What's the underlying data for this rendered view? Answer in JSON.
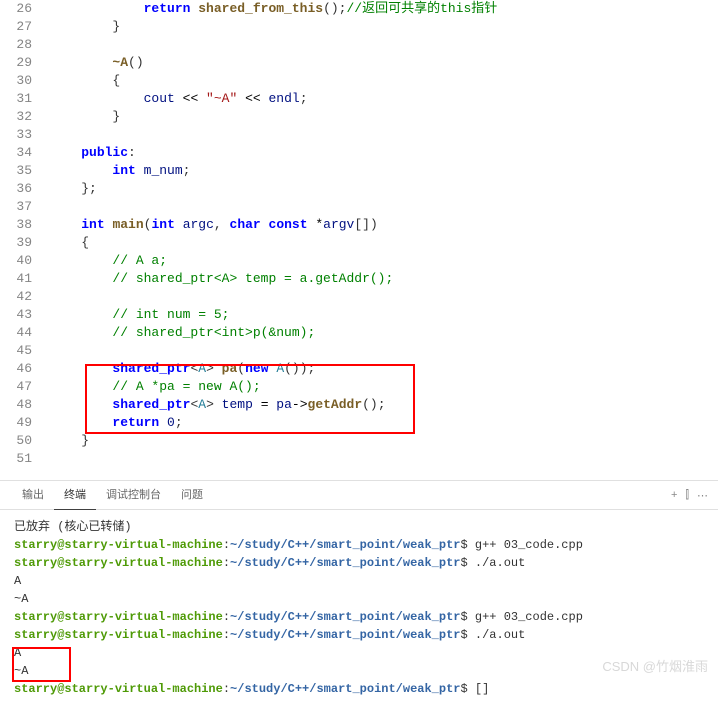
{
  "code": {
    "lines": [
      {
        "num": 26,
        "indent": 3,
        "tokens": [
          {
            "t": "return ",
            "c": "keyword"
          },
          {
            "t": "shared_from_this",
            "c": "funcname"
          },
          {
            "t": "();",
            "c": "punct"
          },
          {
            "t": "//返回可共享的this指针",
            "c": "comment"
          }
        ]
      },
      {
        "num": 27,
        "indent": 2,
        "tokens": [
          {
            "t": "}",
            "c": "punct"
          }
        ]
      },
      {
        "num": 28,
        "indent": 0,
        "tokens": []
      },
      {
        "num": 29,
        "indent": 2,
        "tokens": [
          {
            "t": "~A",
            "c": "funcname"
          },
          {
            "t": "()",
            "c": "punct"
          }
        ]
      },
      {
        "num": 30,
        "indent": 2,
        "tokens": [
          {
            "t": "{",
            "c": "punct"
          }
        ]
      },
      {
        "num": 31,
        "indent": 3,
        "tokens": [
          {
            "t": "cout ",
            "c": "varname"
          },
          {
            "t": "<< ",
            "c": "operator"
          },
          {
            "t": "\"~A\"",
            "c": "string"
          },
          {
            "t": " << ",
            "c": "operator"
          },
          {
            "t": "endl",
            "c": "varname"
          },
          {
            "t": ";",
            "c": "punct"
          }
        ]
      },
      {
        "num": 32,
        "indent": 2,
        "tokens": [
          {
            "t": "}",
            "c": "punct"
          }
        ]
      },
      {
        "num": 33,
        "indent": 0,
        "tokens": []
      },
      {
        "num": 34,
        "indent": 1,
        "tokens": [
          {
            "t": "public",
            "c": "keyword"
          },
          {
            "t": ":",
            "c": "punct"
          }
        ]
      },
      {
        "num": 35,
        "indent": 2,
        "tokens": [
          {
            "t": "int ",
            "c": "keyword"
          },
          {
            "t": "m_num",
            "c": "varname"
          },
          {
            "t": ";",
            "c": "punct"
          }
        ]
      },
      {
        "num": 36,
        "indent": 1,
        "tokens": [
          {
            "t": "};",
            "c": "punct"
          }
        ]
      },
      {
        "num": 37,
        "indent": 0,
        "tokens": []
      },
      {
        "num": 38,
        "indent": 1,
        "tokens": [
          {
            "t": "int ",
            "c": "keyword"
          },
          {
            "t": "main",
            "c": "funcname"
          },
          {
            "t": "(",
            "c": "punct"
          },
          {
            "t": "int ",
            "c": "keyword"
          },
          {
            "t": "argc",
            "c": "varname"
          },
          {
            "t": ", ",
            "c": "punct"
          },
          {
            "t": "char const ",
            "c": "keyword"
          },
          {
            "t": "*",
            "c": "operator"
          },
          {
            "t": "argv",
            "c": "varname"
          },
          {
            "t": "[])",
            "c": "punct"
          }
        ]
      },
      {
        "num": 39,
        "indent": 1,
        "tokens": [
          {
            "t": "{",
            "c": "punct"
          }
        ]
      },
      {
        "num": 40,
        "indent": 2,
        "tokens": [
          {
            "t": "// A a;",
            "c": "comment"
          }
        ]
      },
      {
        "num": 41,
        "indent": 2,
        "tokens": [
          {
            "t": "// shared_ptr<A> temp = a.getAddr();",
            "c": "comment"
          }
        ]
      },
      {
        "num": 42,
        "indent": 0,
        "tokens": []
      },
      {
        "num": 43,
        "indent": 2,
        "tokens": [
          {
            "t": "// int num = 5;",
            "c": "comment"
          }
        ]
      },
      {
        "num": 44,
        "indent": 2,
        "tokens": [
          {
            "t": "// shared_ptr<int>p(&num);",
            "c": "comment"
          }
        ]
      },
      {
        "num": 45,
        "indent": 0,
        "tokens": []
      },
      {
        "num": 46,
        "indent": 2,
        "tokens": [
          {
            "t": "shared_ptr",
            "c": "keyword"
          },
          {
            "t": "<",
            "c": "punct"
          },
          {
            "t": "A",
            "c": "type"
          },
          {
            "t": "> ",
            "c": "punct"
          },
          {
            "t": "pa",
            "c": "funcname"
          },
          {
            "t": "(",
            "c": "punct"
          },
          {
            "t": "new ",
            "c": "keyword"
          },
          {
            "t": "A",
            "c": "type"
          },
          {
            "t": "());",
            "c": "punct"
          }
        ]
      },
      {
        "num": 47,
        "indent": 2,
        "tokens": [
          {
            "t": "// A *pa = new A();",
            "c": "comment"
          }
        ]
      },
      {
        "num": 48,
        "indent": 2,
        "tokens": [
          {
            "t": "shared_ptr",
            "c": "keyword"
          },
          {
            "t": "<",
            "c": "punct"
          },
          {
            "t": "A",
            "c": "type"
          },
          {
            "t": "> ",
            "c": "punct"
          },
          {
            "t": "temp ",
            "c": "varname"
          },
          {
            "t": "= ",
            "c": "operator"
          },
          {
            "t": "pa",
            "c": "varname"
          },
          {
            "t": "->",
            "c": "operator"
          },
          {
            "t": "getAddr",
            "c": "funcname"
          },
          {
            "t": "();",
            "c": "punct"
          }
        ]
      },
      {
        "num": 49,
        "indent": 2,
        "tokens": [
          {
            "t": "return ",
            "c": "keyword"
          },
          {
            "t": "0",
            "c": "varname"
          },
          {
            "t": ";",
            "c": "punct"
          }
        ]
      },
      {
        "num": 50,
        "indent": 1,
        "tokens": [
          {
            "t": "}",
            "c": "punct"
          }
        ]
      },
      {
        "num": 51,
        "indent": 0,
        "tokens": []
      }
    ]
  },
  "tabs": {
    "output": "输出",
    "terminal": "终端",
    "debug": "调试控制台",
    "problems": "问题"
  },
  "icons": {
    "add": "+",
    "split": "⫿",
    "more": "⋯"
  },
  "terminal": {
    "status": "已放弃 (核心已转储)",
    "user": "starry@starry-virtual-machine",
    "path": "~/study/C++/smart_point/weak_ptr",
    "cmd_compile": "g++ 03_code.cpp",
    "cmd_run": "./a.out",
    "out_A": "A",
    "out_destA": "~A",
    "cursor": "[]"
  },
  "watermark": "CSDN @竹烟淮雨"
}
